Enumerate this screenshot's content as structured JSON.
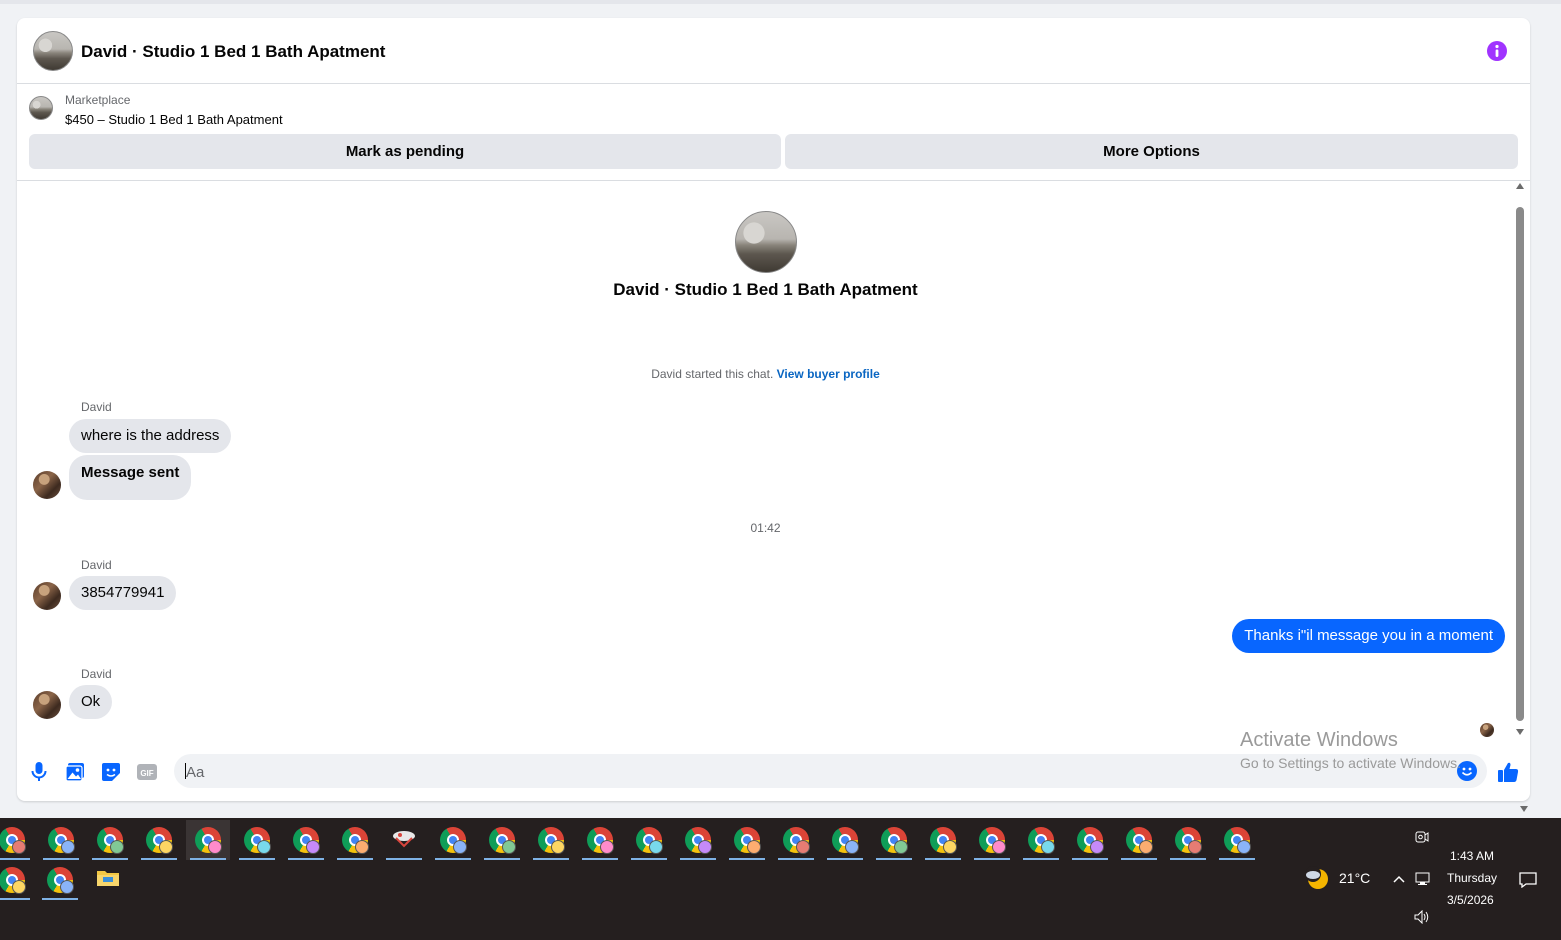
{
  "conversation": {
    "title": "David · Studio 1 Bed 1 Bath Apatment",
    "info_icon": "info-icon"
  },
  "listing": {
    "kicker": "Marketplace",
    "price_title": "$450 – Studio 1 Bed 1 Bath Apatment",
    "mark_pending_label": "Mark as pending",
    "more_options_label": "More Options"
  },
  "thread": {
    "intro_title": "David · Studio 1 Bed 1 Bath Apatment",
    "started_text": "David started this chat.",
    "view_profile_link": "View buyer profile",
    "timestamp": "01:42",
    "messages": [
      {
        "sender": "David",
        "text": "where is the address"
      },
      {
        "text": "Message sent"
      },
      {
        "sender": "David",
        "text": "3854779941"
      },
      {
        "text": "Thanks i\"il message you in a moment",
        "outgoing": true
      },
      {
        "sender": "David",
        "text": "Ok"
      }
    ]
  },
  "composer": {
    "placeholder": "Aa",
    "icons": [
      "microphone-icon",
      "photo-icon",
      "sticker-icon",
      "gif-icon",
      "emoji-icon",
      "thumbs-up-icon"
    ],
    "gif_text": "GIF"
  },
  "watermark": {
    "line1": "Activate Windows",
    "line2": "Go to Settings to activate Windows."
  },
  "taskbar": {
    "temperature": "21°C",
    "time": "1:43 AM",
    "day": "Thursday",
    "date": "3/5/2026"
  },
  "colors": {
    "accent_blue": "#0866ff",
    "link_blue": "#0a66c2",
    "info_purple": "#a033ff",
    "bubble_gray": "#e4e6eb",
    "taskbar_bg": "#251f1f"
  }
}
